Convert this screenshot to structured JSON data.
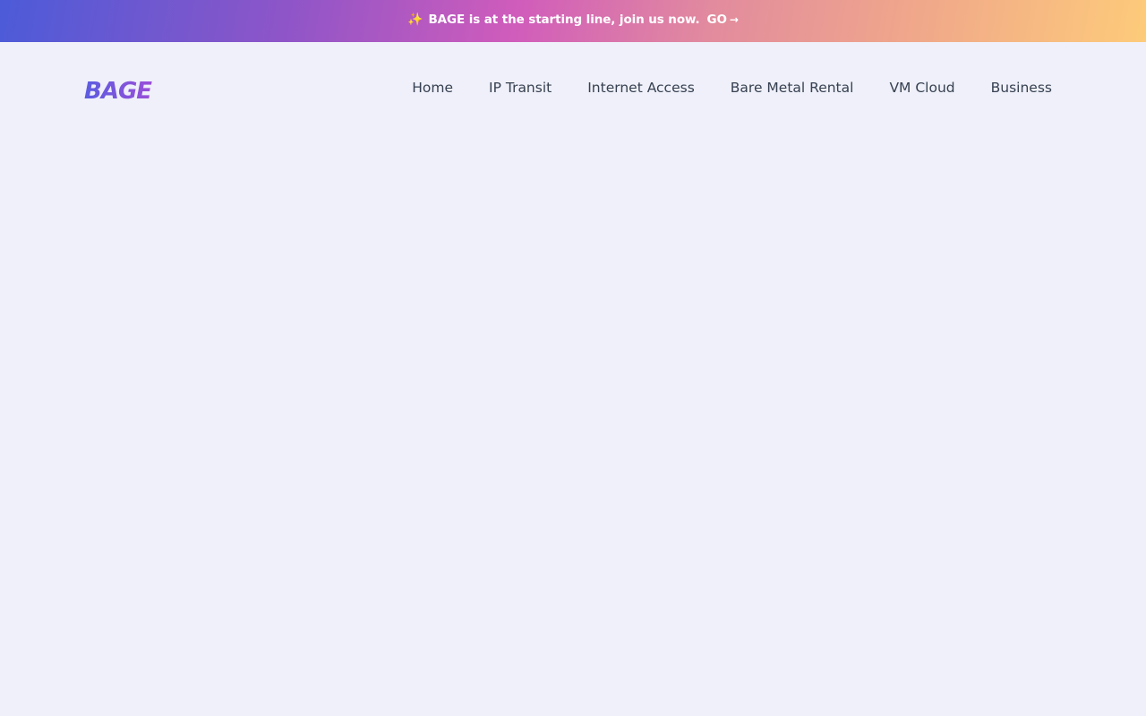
{
  "banner": {
    "icon": "sparkle-icon",
    "text": "BAGE is at the starting line, join us now.",
    "cta_label": "GO",
    "cta_icon": "arrow-right-icon",
    "colors": [
      "#4c5bd8",
      "#d05cbb",
      "#fdcb7a"
    ]
  },
  "header": {
    "logo_text": "BAGE",
    "logo_colors": [
      "#5b5ce0",
      "#9b4fd8"
    ],
    "nav": [
      {
        "label": "Home"
      },
      {
        "label": "IP Transit"
      },
      {
        "label": "Internet Access"
      },
      {
        "label": "Bare Metal Rental"
      },
      {
        "label": "VM Cloud"
      },
      {
        "label": "Business"
      }
    ]
  },
  "page": {
    "background": "#eff0f9",
    "nav_text_color": "#374151"
  }
}
